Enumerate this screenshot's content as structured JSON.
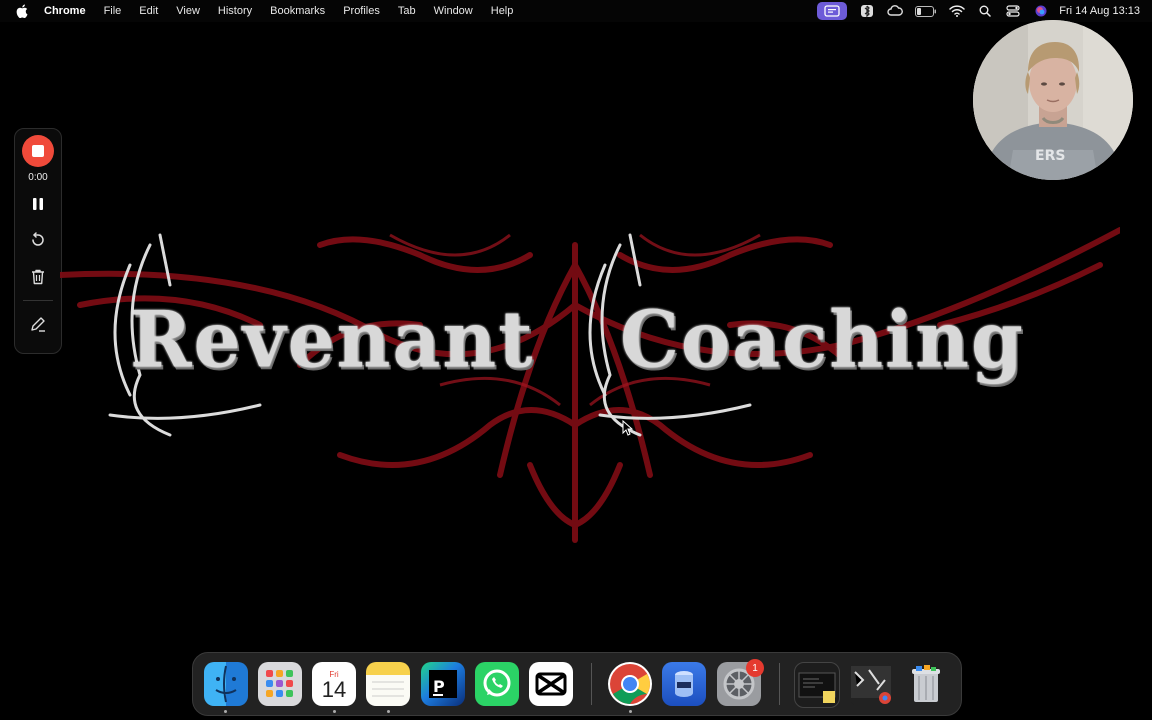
{
  "menubar": {
    "app_name": "Chrome",
    "items": [
      "File",
      "Edit",
      "View",
      "History",
      "Bookmarks",
      "Profiles",
      "Tab",
      "Window",
      "Help"
    ],
    "clock": "Fri 14 Aug  13:13",
    "status_icons": [
      "screen-record-icon",
      "bluetooth-icon",
      "creative-cloud-icon",
      "battery-icon",
      "wifi-icon",
      "spotlight-search-icon",
      "control-center-icon",
      "siri-icon"
    ]
  },
  "recorder": {
    "timer": "0:00",
    "tools": [
      "stop-record-button",
      "pause-icon",
      "restart-icon",
      "trash-icon",
      "pen-icon"
    ]
  },
  "logo": {
    "word1": "Revenant",
    "word2": "Coaching"
  },
  "dock": {
    "apps": [
      {
        "name": "finder",
        "running": true
      },
      {
        "name": "launchpad",
        "running": false
      },
      {
        "name": "calendar",
        "running": true,
        "day_label": "Fri",
        "date": "14"
      },
      {
        "name": "notes",
        "running": true
      },
      {
        "name": "pycharm",
        "running": false
      },
      {
        "name": "whatsapp",
        "running": false
      },
      {
        "name": "capcut",
        "running": false
      },
      {
        "name": "chrome",
        "running": true
      },
      {
        "name": "docker-desktop",
        "running": false
      },
      {
        "name": "system-settings",
        "running": false,
        "badge": "1"
      },
      {
        "name": "recent-window-1",
        "running": false
      },
      {
        "name": "recent-window-2",
        "running": false
      },
      {
        "name": "trash",
        "running": false
      }
    ]
  },
  "colors": {
    "background": "#000000",
    "record_red": "#f04a3a",
    "menubar_accent": "#6d5bd8",
    "logo_red": "#8a0f16",
    "logo_white": "#d8d8d8"
  }
}
